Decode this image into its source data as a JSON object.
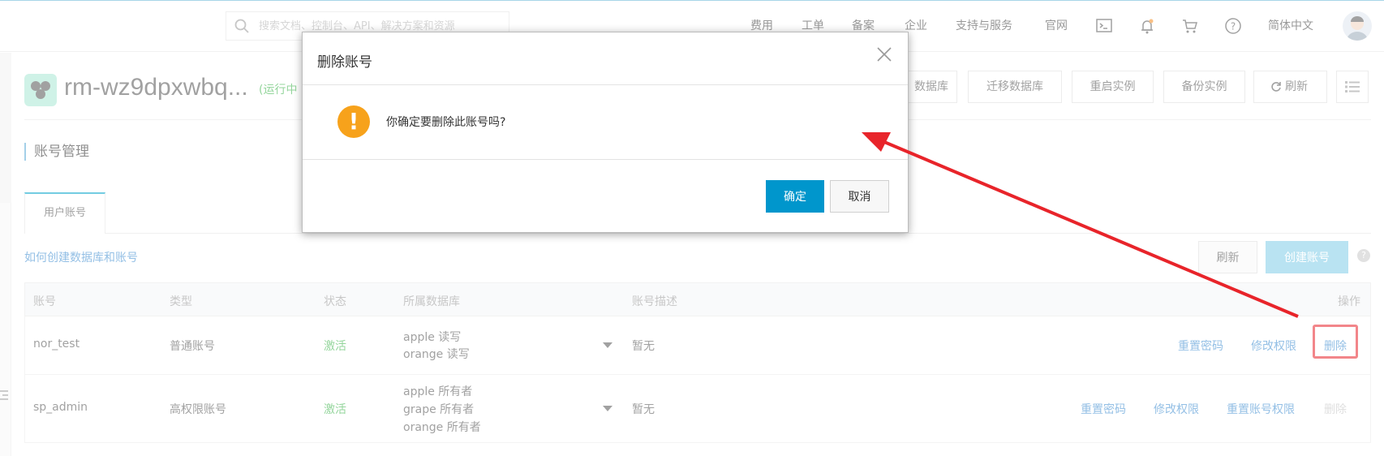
{
  "topbar": {
    "search_placeholder": "搜索文档、控制台、API、解决方案和资源",
    "nav": [
      "费用",
      "工单",
      "备案",
      "企业",
      "支持与服务",
      "官网"
    ],
    "language": "简体中文",
    "icons": [
      "terminal-icon",
      "bell-icon",
      "cart-icon",
      "help-icon"
    ]
  },
  "instance": {
    "name": "rm-wz9dpxwbq...",
    "status": "(运行中",
    "buttons": [
      "数据库",
      "迁移数据库",
      "重启实例",
      "备份实例",
      "刷新"
    ]
  },
  "section_title": "账号管理",
  "tab_label": "用户账号",
  "help_link": "如何创建数据库和账号",
  "toolbar": {
    "refresh": "刷新",
    "create": "创建账号",
    "help": "?"
  },
  "table": {
    "headers": [
      "账号",
      "类型",
      "状态",
      "所属数据库",
      "账号描述",
      "操作"
    ],
    "rows": [
      {
        "account": "nor_test",
        "type": "普通账号",
        "status": "激活",
        "databases": [
          "apple 读写",
          "orange 读写"
        ],
        "description": "暂无",
        "actions": [
          "重置密码",
          "修改权限",
          "删除"
        ]
      },
      {
        "account": "sp_admin",
        "type": "高权限账号",
        "status": "激活",
        "databases": [
          "apple 所有者",
          "grape 所有者",
          "orange 所有者"
        ],
        "description": "暂无",
        "actions": [
          "重置密码",
          "修改权限",
          "重置账号权限",
          "删除"
        ]
      }
    ]
  },
  "modal": {
    "title": "删除账号",
    "message": "你确定要删除此账号吗?",
    "ok": "确定",
    "cancel": "取消"
  },
  "colors": {
    "primary": "#0096cc",
    "link": "#3b8bcf",
    "success": "#3bb34a",
    "warning": "#f7a21b",
    "annotation": "#e8242a"
  }
}
